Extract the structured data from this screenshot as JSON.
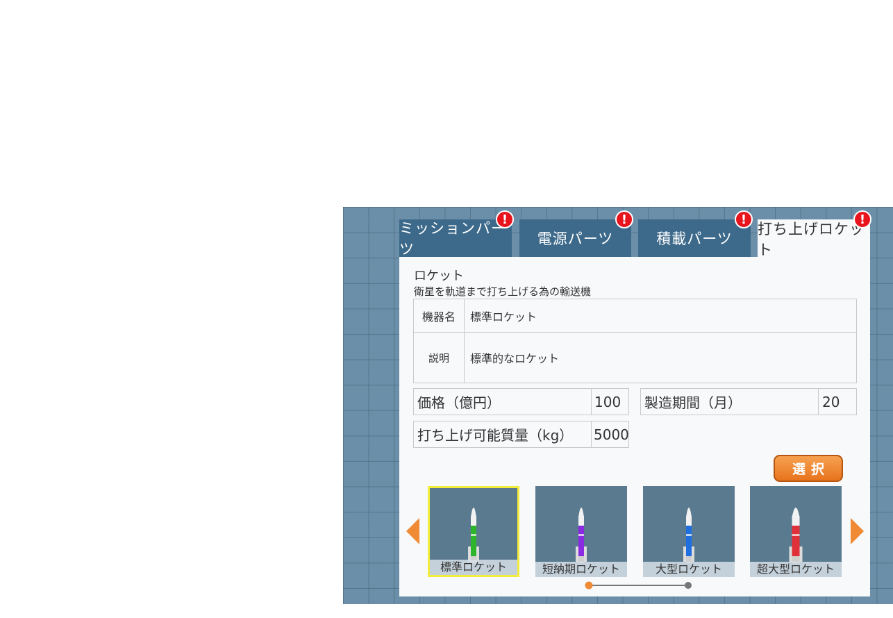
{
  "tabs": [
    {
      "label": "ミッションパーツ",
      "alert": "!"
    },
    {
      "label": "電源パーツ",
      "alert": "!"
    },
    {
      "label": "積載パーツ",
      "alert": "!"
    },
    {
      "label": "打ち上げロケット",
      "alert": "!"
    }
  ],
  "active_tab": 3,
  "section": {
    "title": "ロケット",
    "subtitle": "衛星を軌道まで打ち上げる為の輸送機"
  },
  "info": {
    "name_label": "機器名",
    "name_value": "標準ロケット",
    "desc_label": "説明",
    "desc_value": "標準的なロケット"
  },
  "specs": {
    "price_label": "価格（億円）",
    "price_value": "100",
    "period_label": "製造期間（月）",
    "period_value": "20",
    "payload_label": "打ち上げ可能質量（kg）",
    "payload_value": "5000"
  },
  "select_label": "選択",
  "rockets": [
    {
      "label": "標準ロケット",
      "color": "#2fb52c",
      "selected": true
    },
    {
      "label": "短納期ロケット",
      "color": "#8a2be2",
      "selected": false
    },
    {
      "label": "大型ロケット",
      "color": "#1f6fe0",
      "selected": false
    },
    {
      "label": "超大型ロケット",
      "color": "#e0303a",
      "selected": false
    }
  ],
  "pager": {
    "current": 1,
    "total": 2
  },
  "colors": {
    "accent": "#f08a35",
    "tab": "#3d6a8b",
    "alert": "#e8141d",
    "selection": "#f2ec3c"
  }
}
